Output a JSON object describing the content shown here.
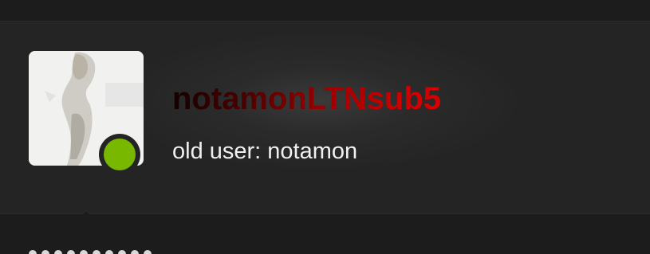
{
  "profile": {
    "username": "notamonLTNsub5",
    "subtitle": "old user: notamon",
    "status": "online",
    "status_color": "#78b800",
    "username_gradient_colors": [
      "#140000",
      "#d00000"
    ],
    "avatar_icon": "user-avatar-image"
  }
}
